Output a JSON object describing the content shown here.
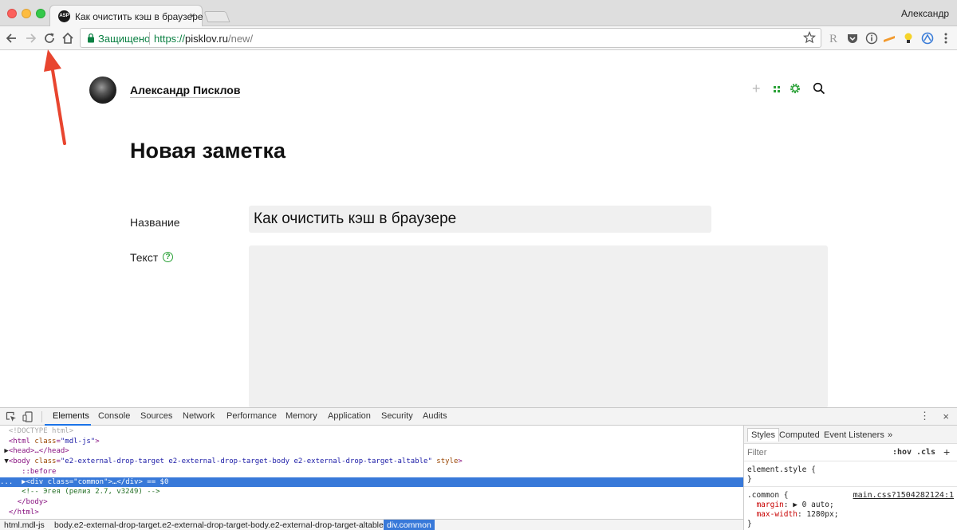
{
  "browser": {
    "tab_title": "Как очистить кэш в браузере",
    "tab_favicon_text": "ASP",
    "tab_close": "×",
    "profile_name": "Александр",
    "secure_label": "Защищено",
    "url_scheme": "https://",
    "url_host": "pisklov.ru",
    "url_path": "/new/"
  },
  "page": {
    "author": "Александр Писклов",
    "title": "Новая заметка",
    "field_title_label": "Название",
    "field_title_value": "Как очистить кэш в браузере",
    "field_text_label": "Текст",
    "help_glyph": "?",
    "plus_glyph": "+"
  },
  "devtools": {
    "tabs": [
      "Elements",
      "Console",
      "Sources",
      "Network",
      "Performance",
      "Memory",
      "Application",
      "Security",
      "Audits"
    ],
    "active_tab": "Elements",
    "more_glyph": "⋮",
    "close_glyph": "×",
    "dom": {
      "doctype": "<!DOCTYPE html>",
      "html_open": "<html",
      "html_class_attr": "class",
      "html_class_val": "\"mdl-js\"",
      "head": "<head>…</head>",
      "body_open": "<body",
      "body_class_attr": "class",
      "body_class_val": "\"e2-external-drop-target e2-external-drop-target-body e2-external-drop-target-altable\"",
      "body_style_attr": "style",
      "before": "::before",
      "div_dots": "...",
      "div_open": "<div",
      "div_class_attr": "class",
      "div_class_val": "\"common\"",
      "div_rest": ">…</div>",
      "div_eq": "== $0",
      "comment": "<!-- Эгея (релиз 2.7, v3249) -->",
      "body_close": "</body>",
      "html_close": "</html>"
    },
    "breadcrumbs": [
      "html.mdl-js",
      "body.e2-external-drop-target.e2-external-drop-target-body.e2-external-drop-target-altable",
      "div.common"
    ],
    "styles": {
      "tabs": [
        "Styles",
        "Computed",
        "Event Listeners"
      ],
      "more_tabs": "»",
      "filter_placeholder": "Filter",
      "hov": ":hov",
      "cls": ".cls",
      "add": "+",
      "element_style_selector": "element.style {",
      "close_brace": "}",
      "common_selector": ".common {",
      "common_source": "main.css?1504282124:1",
      "prop1_name": "margin",
      "prop1_value": "▶ 0 auto;",
      "prop2_name": "max-width",
      "prop2_value": "1280px;"
    }
  },
  "colors": {
    "secure_green": "#0b8043",
    "accent_green": "#2aa137",
    "devtools_selection": "#3879d9",
    "annotation_arrow": "#e8452f"
  }
}
